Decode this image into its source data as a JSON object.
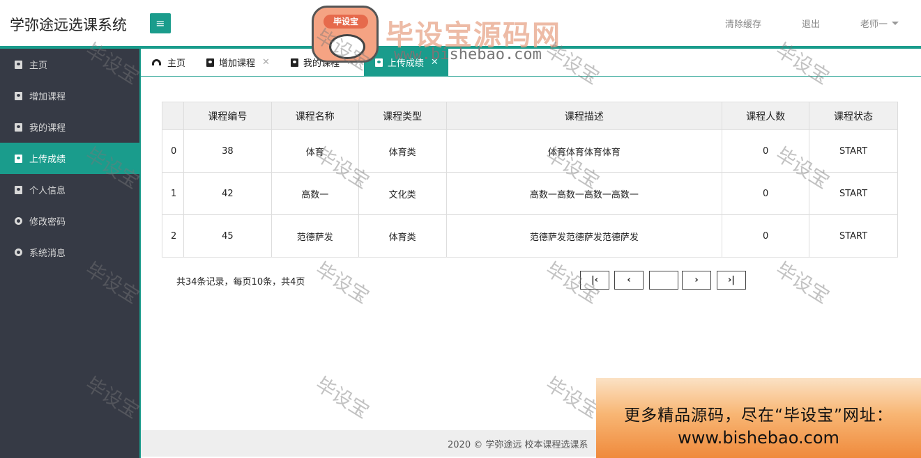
{
  "header": {
    "app_title": "学弥途远选课系统",
    "menu_icon": "≡",
    "clear_cache": "清除缓存",
    "logout": "退出",
    "user_name": "老师一"
  },
  "sidebar": {
    "items": [
      {
        "label": "主页",
        "icon": "book-icon",
        "active": false
      },
      {
        "label": "增加课程",
        "icon": "book-icon",
        "active": false
      },
      {
        "label": "我的课程",
        "icon": "book-icon",
        "active": false
      },
      {
        "label": "上传成绩",
        "icon": "book-icon",
        "active": true
      },
      {
        "label": "个人信息",
        "icon": "book-icon",
        "active": false
      },
      {
        "label": "修改密码",
        "icon": "circle-icon",
        "active": false
      },
      {
        "label": "系统消息",
        "icon": "circle-icon",
        "active": false
      }
    ]
  },
  "tabs": [
    {
      "label": "主页",
      "closable": false,
      "active": false
    },
    {
      "label": "增加课程",
      "closable": true,
      "active": false
    },
    {
      "label": "我的课程",
      "closable": true,
      "active": false
    },
    {
      "label": "上传成绩",
      "closable": true,
      "active": true
    }
  ],
  "table": {
    "columns": [
      "",
      "课程编号",
      "课程名称",
      "课程类型",
      "课程描述",
      "课程人数",
      "课程状态"
    ],
    "rows": [
      [
        "0",
        "38",
        "体育",
        "体育类",
        "体育体育体育体育",
        "0",
        "START"
      ],
      [
        "1",
        "42",
        "高数一",
        "文化类",
        "高数一高数一高数一高数一",
        "0",
        "START"
      ],
      [
        "2",
        "45",
        "范德萨发",
        "体育类",
        "范德萨发范德萨发范德萨发",
        "0",
        "START"
      ]
    ]
  },
  "pager": {
    "info": "共34条记录，每页10条，共4页",
    "first": "|‹",
    "prev": "‹",
    "next": "›",
    "last": "›|",
    "page_value": ""
  },
  "footer": {
    "text": "2020 ©  学弥途远  校本课程选课系"
  },
  "promo": {
    "line1": "更多精品源码，尽在“毕设宝”网址：",
    "line2": "www.bishebao.com"
  },
  "logo": {
    "badge_text": "毕设宝",
    "title": "毕设宝源码网",
    "url": "www.bishebao.com"
  },
  "watermark": "毕设宝",
  "colors": {
    "accent": "#1a9c8c",
    "sidebar_bg": "#363a45"
  }
}
